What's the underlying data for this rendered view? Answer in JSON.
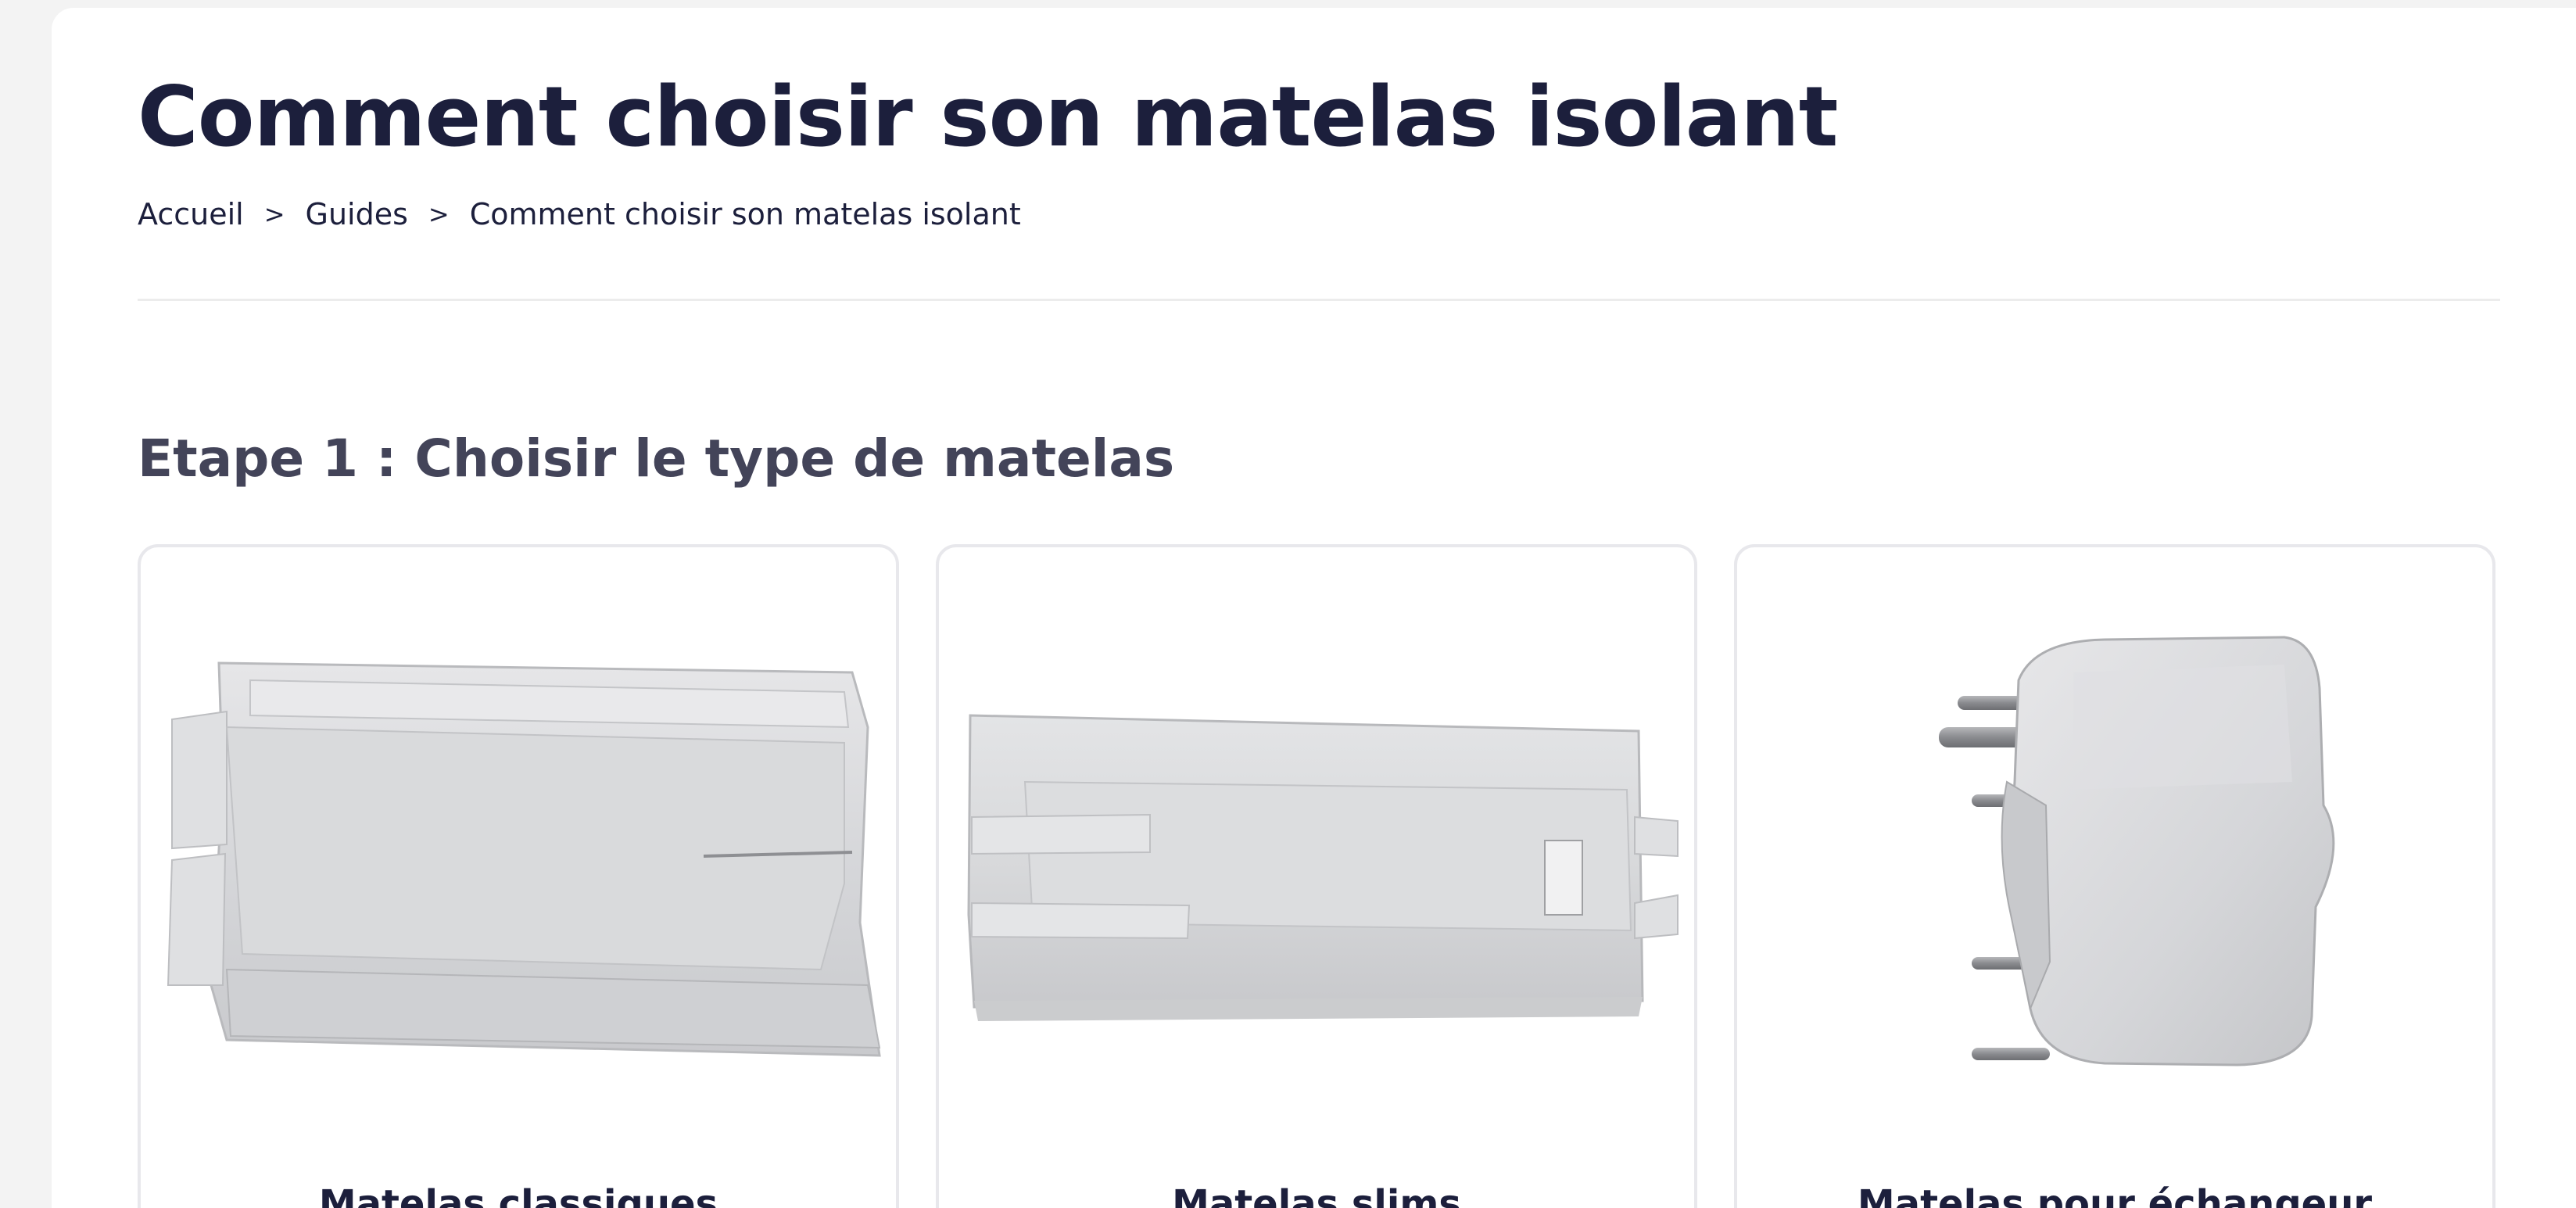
{
  "page": {
    "title": "Comment choisir son matelas isolant"
  },
  "breadcrumb": {
    "items": [
      "Accueil",
      "Guides",
      "Comment choisir son matelas isolant"
    ],
    "separator": ">"
  },
  "step": {
    "title": "Etape 1 : Choisir le type de matelas"
  },
  "cards": [
    {
      "label": "Matelas classiques",
      "image": "grey-insulation-blanket-flat"
    },
    {
      "label": "Matelas slims",
      "image": "grey-insulation-blanket-slim"
    },
    {
      "label": "Matelas pour échangeur",
      "image": "grey-insulation-cover-heat-exchanger"
    }
  ],
  "colors": {
    "heading": "#1c1f3c",
    "subheading": "#434459",
    "card_border": "#e8e8ec",
    "background": "#f3f3f3"
  }
}
